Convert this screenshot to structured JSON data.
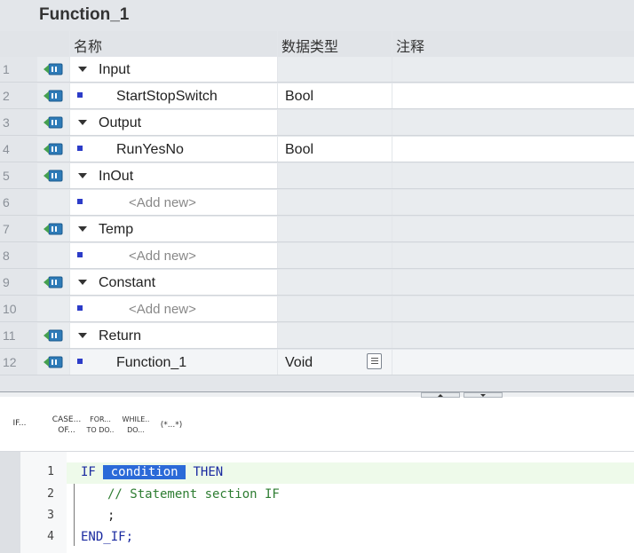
{
  "block": {
    "title": "Function_1"
  },
  "columns": {
    "name": "名称",
    "data_type": "数据类型",
    "comment": "注释"
  },
  "rows": [
    {
      "num": "1",
      "kind": "section",
      "name": "Input",
      "type": "",
      "icon": "interface-icon"
    },
    {
      "num": "2",
      "kind": "var",
      "name": "StartStopSwitch",
      "type": "Bool",
      "icon": "interface-icon"
    },
    {
      "num": "3",
      "kind": "section",
      "name": "Output",
      "type": "",
      "icon": "interface-icon"
    },
    {
      "num": "4",
      "kind": "var",
      "name": "RunYesNo",
      "type": "Bool",
      "icon": "interface-icon"
    },
    {
      "num": "5",
      "kind": "section",
      "name": "InOut",
      "type": "",
      "icon": "interface-icon"
    },
    {
      "num": "6",
      "kind": "addnew",
      "name": "<Add new>",
      "type": ""
    },
    {
      "num": "7",
      "kind": "section",
      "name": "Temp",
      "type": "",
      "icon": "interface-icon"
    },
    {
      "num": "8",
      "kind": "addnew",
      "name": "<Add new>",
      "type": ""
    },
    {
      "num": "9",
      "kind": "section",
      "name": "Constant",
      "type": "",
      "icon": "interface-icon"
    },
    {
      "num": "10",
      "kind": "addnew",
      "name": "<Add new>",
      "type": ""
    },
    {
      "num": "11",
      "kind": "section",
      "name": "Return",
      "type": "",
      "icon": "interface-icon"
    },
    {
      "num": "12",
      "kind": "var",
      "name": "Function_1",
      "type": "Void",
      "icon": "interface-icon",
      "selected": true
    }
  ],
  "toolbar": {
    "if": "IF...",
    "case_1": "CASE...",
    "case_2": "OF...",
    "for_1": "FOR...",
    "for_2": "TO DO..",
    "while_1": "WHILE..",
    "while_2": "DO...",
    "comment": "(*...*)"
  },
  "code": {
    "line_numbers": [
      "1",
      "2",
      "3",
      "4"
    ],
    "l1_kw_if": "IF",
    "l1_condition": "condition",
    "l1_kw_then": "THEN",
    "l2_comment": "// Statement section IF",
    "l3_text": ";",
    "l4_text": "END_IF;"
  },
  "colors": {
    "selection": "#2b6ad8",
    "keyword": "#1a2aa0",
    "comment": "#2e7d32",
    "active_line": "#eefaea"
  }
}
